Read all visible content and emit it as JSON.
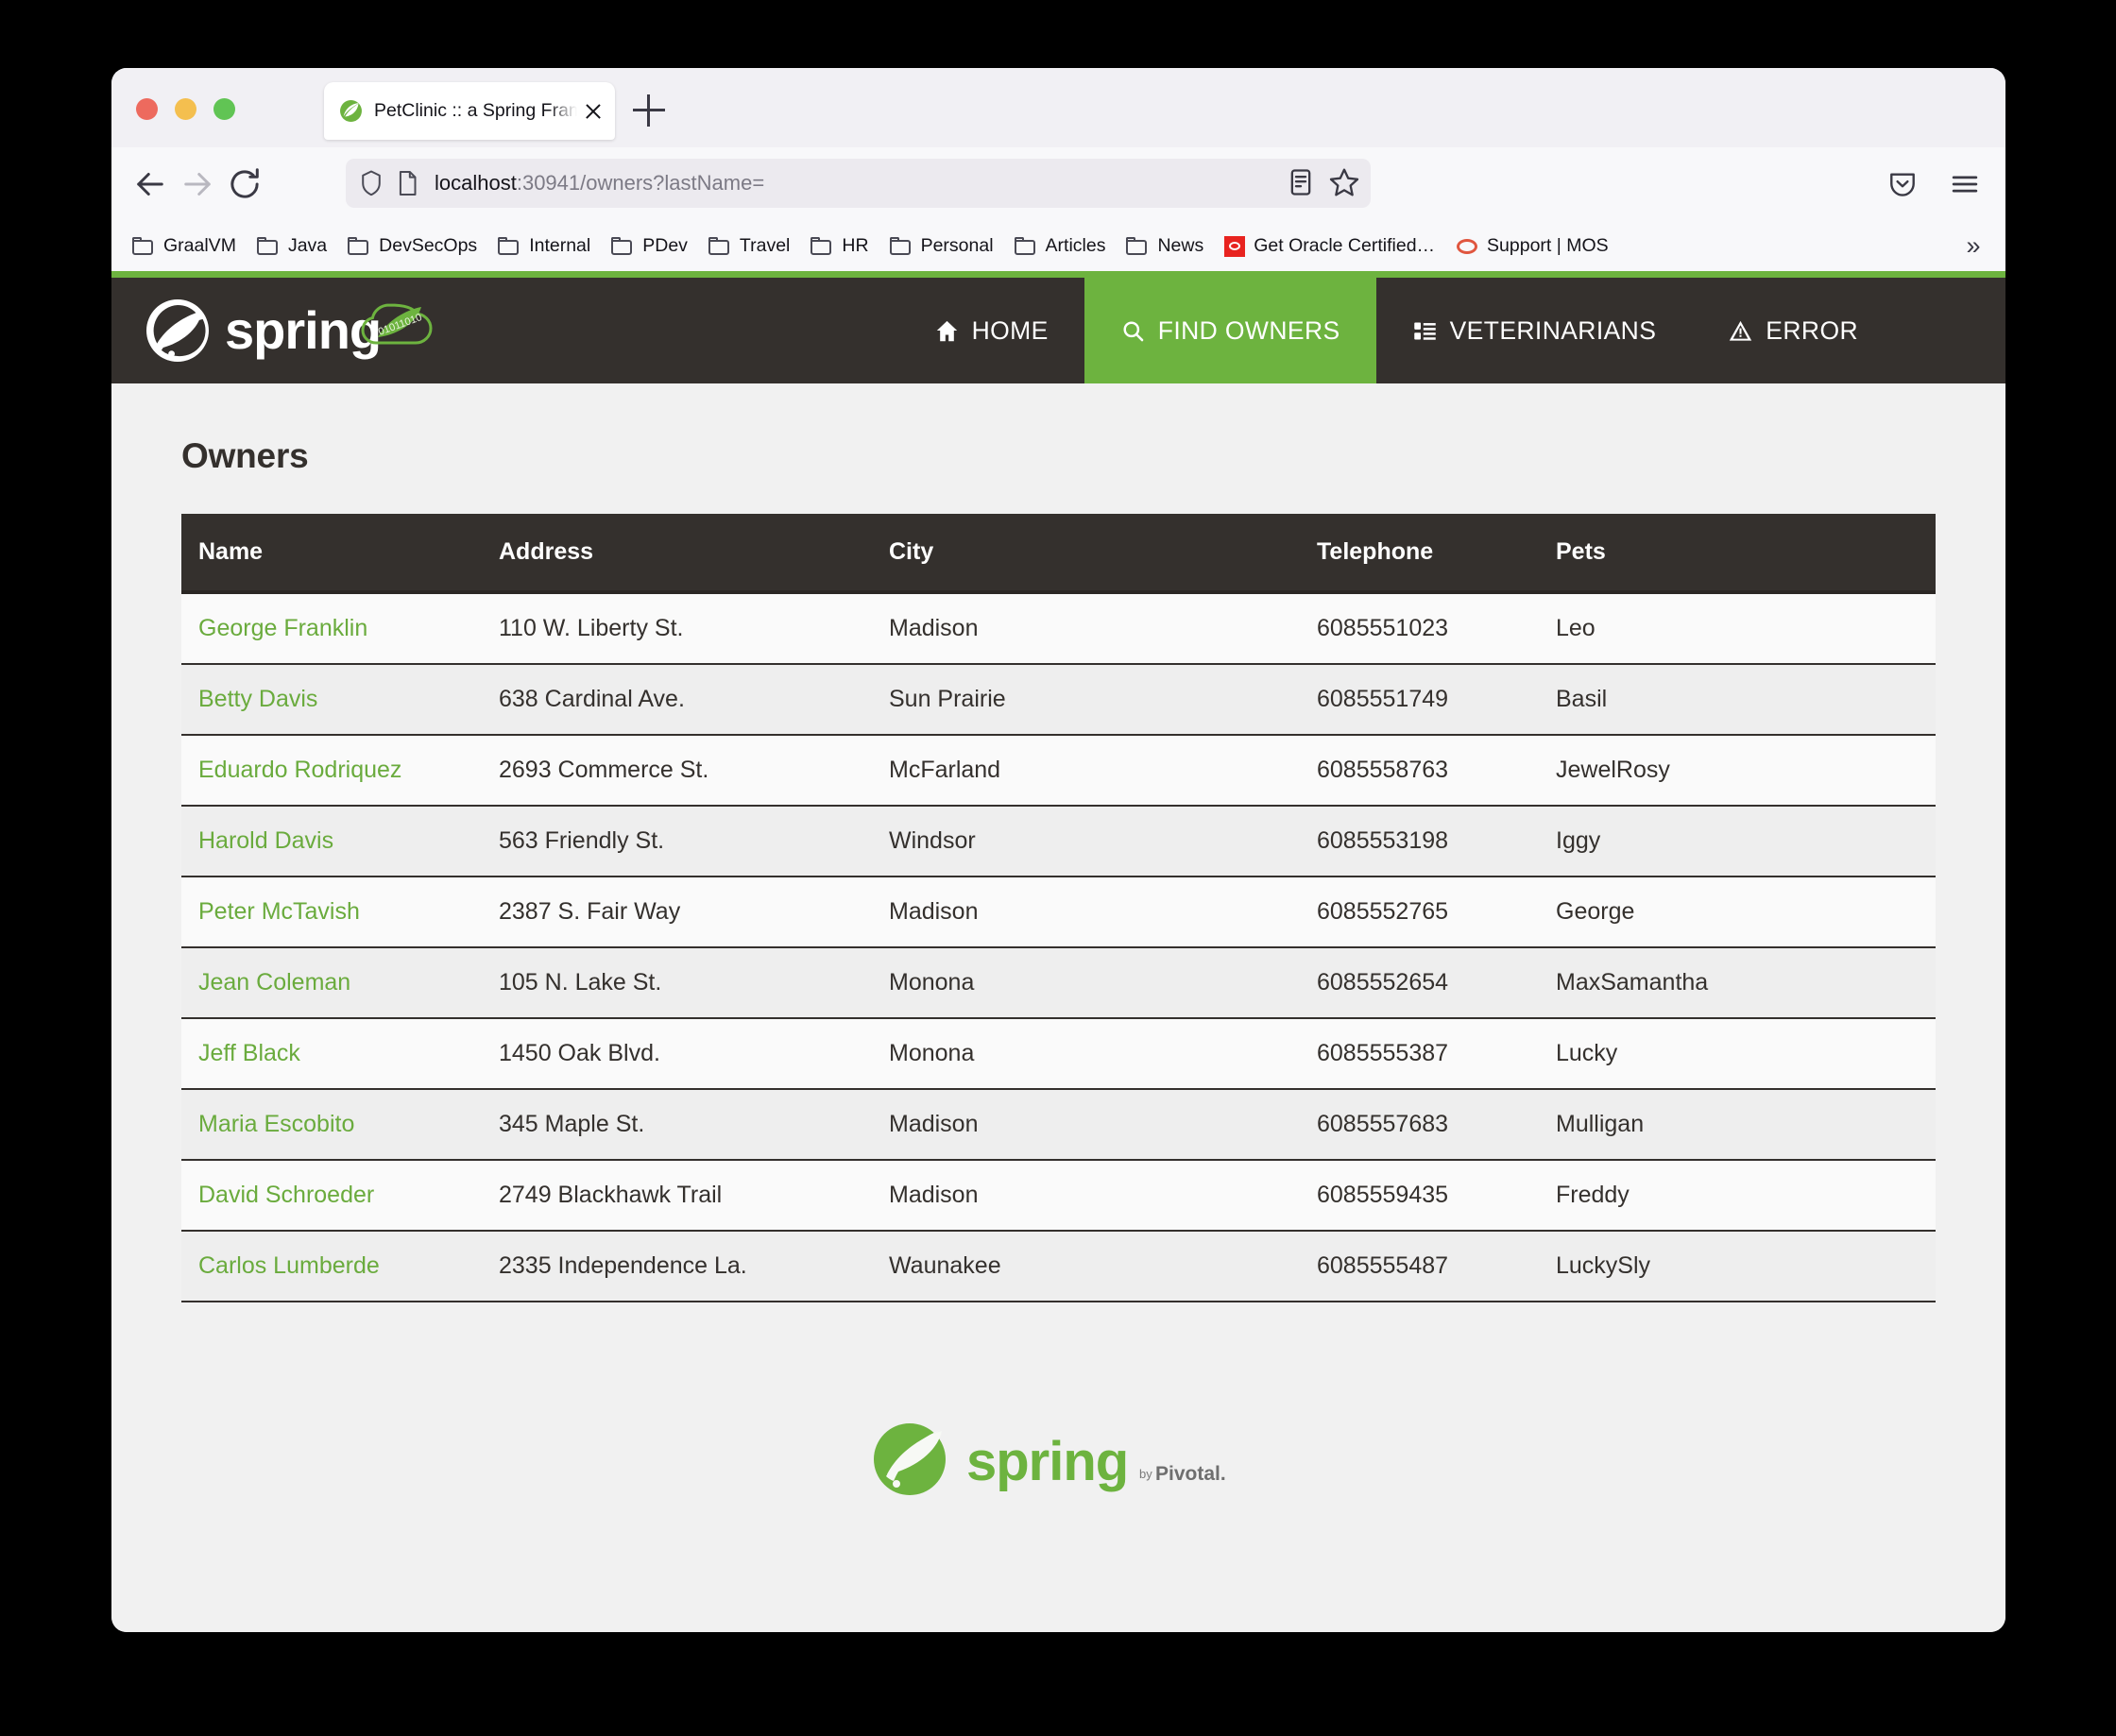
{
  "browser": {
    "tab": {
      "title": "PetClinic :: a Spring Framework",
      "favicon_name": "spring-leaf-favicon",
      "close_label": "Close tab"
    },
    "new_tab_label": "New tab",
    "nav": {
      "back_label": "Back",
      "forward_label": "Forward",
      "reload_label": "Reload"
    },
    "url": {
      "host": "localhost",
      "rest": ":30941/owners?lastName=",
      "full": "localhost:30941/owners?lastName=",
      "shield_icon": "shield-icon",
      "page_icon": "page-icon",
      "reader_icon": "reader-view-icon",
      "bookmark_icon": "star-icon"
    },
    "toolbar": {
      "pocket_icon": "pocket-save-icon",
      "menu_icon": "hamburger-menu-icon"
    },
    "bookmarks": [
      {
        "label": "GraalVM",
        "icon": "folder-icon"
      },
      {
        "label": "Java",
        "icon": "folder-icon"
      },
      {
        "label": "DevSecOps",
        "icon": "folder-icon"
      },
      {
        "label": "Internal",
        "icon": "folder-icon"
      },
      {
        "label": "PDev",
        "icon": "folder-icon"
      },
      {
        "label": "Travel",
        "icon": "folder-icon"
      },
      {
        "label": "HR",
        "icon": "folder-icon"
      },
      {
        "label": "Personal",
        "icon": "folder-icon"
      },
      {
        "label": "Articles",
        "icon": "folder-icon"
      },
      {
        "label": "News",
        "icon": "folder-icon"
      },
      {
        "label": "Get Oracle Certified…",
        "icon": "oracle-square-favicon"
      },
      {
        "label": "Support | MOS",
        "icon": "oracle-outline-favicon"
      }
    ],
    "bookmarks_overflow_label": "»"
  },
  "site": {
    "brand": {
      "wordmark": "spring",
      "logo_name": "spring-logo"
    },
    "accent_green": "#6db33f",
    "nav_bg": "#34302d",
    "nav": [
      {
        "label": "Home",
        "icon": "home-icon",
        "active": false
      },
      {
        "label": "Find owners",
        "icon": "search-icon",
        "active": true
      },
      {
        "label": "Veterinarians",
        "icon": "list-icon",
        "active": false
      },
      {
        "label": "Error",
        "icon": "warning-icon",
        "active": false
      }
    ]
  },
  "main": {
    "title": "Owners",
    "table": {
      "columns": [
        "Name",
        "Address",
        "City",
        "Telephone",
        "Pets"
      ],
      "rows": [
        {
          "name": "George Franklin",
          "address": "110 W. Liberty St.",
          "city": "Madison",
          "telephone": "6085551023",
          "pets": "Leo"
        },
        {
          "name": "Betty Davis",
          "address": "638 Cardinal Ave.",
          "city": "Sun Prairie",
          "telephone": "6085551749",
          "pets": "Basil"
        },
        {
          "name": "Eduardo Rodriquez",
          "address": "2693 Commerce St.",
          "city": "McFarland",
          "telephone": "6085558763",
          "pets": "JewelRosy"
        },
        {
          "name": "Harold Davis",
          "address": "563 Friendly St.",
          "city": "Windsor",
          "telephone": "6085553198",
          "pets": "Iggy"
        },
        {
          "name": "Peter McTavish",
          "address": "2387 S. Fair Way",
          "city": "Madison",
          "telephone": "6085552765",
          "pets": "George"
        },
        {
          "name": "Jean Coleman",
          "address": "105 N. Lake St.",
          "city": "Monona",
          "telephone": "6085552654",
          "pets": "MaxSamantha"
        },
        {
          "name": "Jeff Black",
          "address": "1450 Oak Blvd.",
          "city": "Monona",
          "telephone": "6085555387",
          "pets": "Lucky"
        },
        {
          "name": "Maria Escobito",
          "address": "345 Maple St.",
          "city": "Madison",
          "telephone": "6085557683",
          "pets": "Mulligan"
        },
        {
          "name": "David Schroeder",
          "address": "2749 Blackhawk Trail",
          "city": "Madison",
          "telephone": "6085559435",
          "pets": "Freddy"
        },
        {
          "name": "Carlos Lumberde",
          "address": "2335 Independence La.",
          "city": "Waunakee",
          "telephone": "6085555487",
          "pets": "LuckySly"
        }
      ]
    }
  },
  "footer": {
    "wordmark": "spring",
    "byline": "by Pivotal.",
    "logo_name": "spring-footer-logo"
  }
}
